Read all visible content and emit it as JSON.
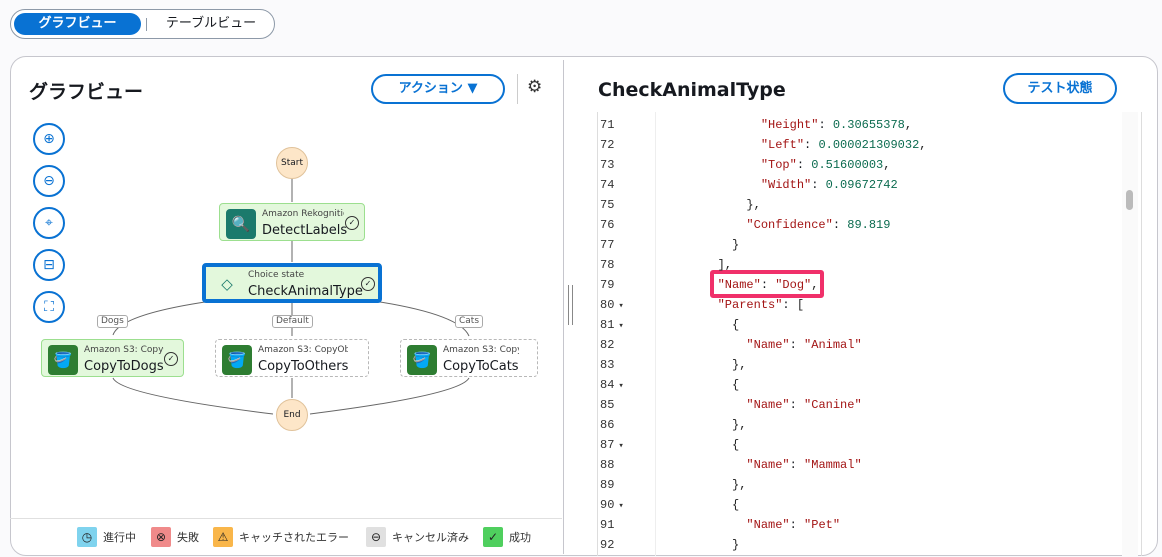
{
  "view_toggle": {
    "graph": "グラフビュー",
    "table": "テーブルビュー"
  },
  "graph_panel": {
    "title": "グラフビュー",
    "action_label": "アクション ▼",
    "settings_icon": "gear-icon",
    "controls": [
      "zoom-in-icon",
      "zoom-out-icon",
      "center-icon",
      "collapse-icon",
      "fit-screen-icon"
    ]
  },
  "graph": {
    "start": "Start",
    "end": "End",
    "detect": {
      "sub": "Amazon Rekognitio",
      "title": "DetectLabels"
    },
    "choice": {
      "sub": "Choice state",
      "title": "CheckAnimalType"
    },
    "dogs": {
      "sub": "Amazon S3: CopyO",
      "title": "CopyToDogs",
      "edge": "Dogs"
    },
    "others": {
      "sub": "Amazon S3: CopyObj",
      "title": "CopyToOthers",
      "edge": "Default"
    },
    "cats": {
      "sub": "Amazon S3: Copy",
      "title": "CopyToCats",
      "edge": "Cats"
    }
  },
  "legend": [
    {
      "label": "進行中",
      "color": "#7fd3ee",
      "icon": "clock-icon"
    },
    {
      "label": "失敗",
      "color": "#f08a8a",
      "icon": "x-circle-icon"
    },
    {
      "label": "キャッチされたエラー",
      "color": "#f9b64a",
      "icon": "warning-icon"
    },
    {
      "label": "キャンセル済み",
      "color": "#e0e0e0",
      "icon": "minus-circle-icon"
    },
    {
      "label": "成功",
      "color": "#4fcf5e",
      "icon": "check-circle-icon"
    }
  ],
  "detail_panel": {
    "title": "CheckAnimalType",
    "test_state_label": "テスト状態"
  },
  "code_lines": [
    {
      "n": "71",
      "f": "",
      "i": 14,
      "k": "\"Height\"",
      "v": "0.30655378",
      "t": "n",
      "e": ","
    },
    {
      "n": "72",
      "f": "",
      "i": 14,
      "k": "\"Left\"",
      "v": "0.000021309032",
      "t": "n",
      "e": ","
    },
    {
      "n": "73",
      "f": "",
      "i": 14,
      "k": "\"Top\"",
      "v": "0.51600003",
      "t": "n",
      "e": ","
    },
    {
      "n": "74",
      "f": "",
      "i": 14,
      "k": "\"Width\"",
      "v": "0.09672742",
      "t": "n",
      "e": ""
    },
    {
      "n": "75",
      "f": "",
      "i": 12,
      "k": "",
      "v": "",
      "t": "p",
      "e": "},"
    },
    {
      "n": "76",
      "f": "",
      "i": 12,
      "k": "\"Confidence\"",
      "v": "89.819",
      "t": "n",
      "e": ""
    },
    {
      "n": "77",
      "f": "",
      "i": 10,
      "k": "",
      "v": "",
      "t": "p",
      "e": "}"
    },
    {
      "n": "78",
      "f": "",
      "i": 8,
      "k": "",
      "v": "",
      "t": "p",
      "e": "],"
    },
    {
      "n": "79",
      "f": "",
      "i": 8,
      "k": "\"Name\"",
      "v": "\"Dog\"",
      "t": "s",
      "e": ","
    },
    {
      "n": "80",
      "f": "▾",
      "i": 8,
      "k": "\"Parents\"",
      "v": "[",
      "t": "p",
      "e": ""
    },
    {
      "n": "81",
      "f": "▾",
      "i": 10,
      "k": "",
      "v": "",
      "t": "p",
      "e": "{"
    },
    {
      "n": "82",
      "f": "",
      "i": 12,
      "k": "\"Name\"",
      "v": "\"Animal\"",
      "t": "s",
      "e": ""
    },
    {
      "n": "83",
      "f": "",
      "i": 10,
      "k": "",
      "v": "",
      "t": "p",
      "e": "},"
    },
    {
      "n": "84",
      "f": "▾",
      "i": 10,
      "k": "",
      "v": "",
      "t": "p",
      "e": "{"
    },
    {
      "n": "85",
      "f": "",
      "i": 12,
      "k": "\"Name\"",
      "v": "\"Canine\"",
      "t": "s",
      "e": ""
    },
    {
      "n": "86",
      "f": "",
      "i": 10,
      "k": "",
      "v": "",
      "t": "p",
      "e": "},"
    },
    {
      "n": "87",
      "f": "▾",
      "i": 10,
      "k": "",
      "v": "",
      "t": "p",
      "e": "{"
    },
    {
      "n": "88",
      "f": "",
      "i": 12,
      "k": "\"Name\"",
      "v": "\"Mammal\"",
      "t": "s",
      "e": ""
    },
    {
      "n": "89",
      "f": "",
      "i": 10,
      "k": "",
      "v": "",
      "t": "p",
      "e": "},"
    },
    {
      "n": "90",
      "f": "▾",
      "i": 10,
      "k": "",
      "v": "",
      "t": "p",
      "e": "{"
    },
    {
      "n": "91",
      "f": "",
      "i": 12,
      "k": "\"Name\"",
      "v": "\"Pet\"",
      "t": "s",
      "e": ""
    },
    {
      "n": "92",
      "f": "",
      "i": 10,
      "k": "",
      "v": "",
      "t": "p",
      "e": "}"
    }
  ],
  "highlight_color": "#f0306a",
  "accent": "#0972d3"
}
